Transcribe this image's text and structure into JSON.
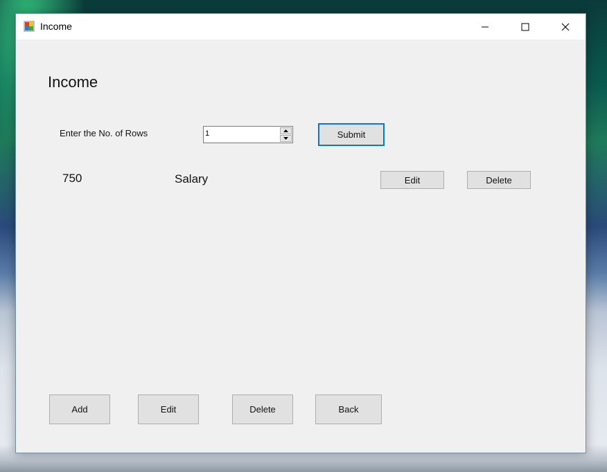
{
  "window": {
    "title": "Income",
    "icon": "windows-form-icon",
    "controls": [
      "minimize-icon",
      "maximize-icon",
      "close-icon"
    ]
  },
  "main": {
    "heading": "Income",
    "rows_label": "Enter the No. of Rows",
    "rows_value": "1",
    "submit_label": "Submit"
  },
  "records": [
    {
      "amount": "750",
      "category": "Salary",
      "edit_label": "Edit",
      "delete_label": "Delete"
    }
  ],
  "footer": {
    "add_label": "Add",
    "edit_label": "Edit",
    "delete_label": "Delete",
    "back_label": "Back"
  },
  "colors": {
    "window_bg": "#f0f0f0",
    "titlebar_bg": "#ffffff",
    "button_bg": "#e1e1e1",
    "button_border": "#adadad",
    "focus_border": "#0078d7"
  }
}
